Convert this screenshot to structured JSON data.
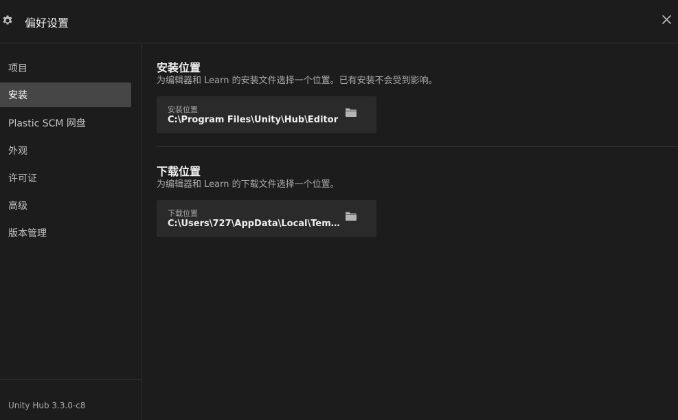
{
  "window": {
    "title": "偏好设置",
    "icons": {
      "settings": "gear-icon",
      "close": "close-icon"
    }
  },
  "sidebar": {
    "items": [
      {
        "label": "项目",
        "active": false
      },
      {
        "label": "安装",
        "active": true
      },
      {
        "label": "Plastic SCM 网盘",
        "active": false
      },
      {
        "label": "外观",
        "active": false
      },
      {
        "label": "许可证",
        "active": false
      },
      {
        "label": "高级",
        "active": false
      },
      {
        "label": "版本管理",
        "active": false
      }
    ],
    "version": "Unity Hub 3.3.0-c8"
  },
  "main": {
    "install": {
      "title": "安装位置",
      "description": "为编辑器和 Learn 的安装文件选择一个位置。已有安装不会受到影响。",
      "field_label": "安装位置",
      "field_value": "C:\\Program Files\\Unity\\Hub\\Editor",
      "icon": "folder-icon"
    },
    "download": {
      "title": "下载位置",
      "description": "为编辑器和 Learn 的下载文件选择一个位置。",
      "field_label": "下载位置",
      "field_value": "C:\\Users\\727\\AppData\\Local\\Temp\\...",
      "icon": "folder-icon"
    }
  },
  "colors": {
    "background": "#1c1c1c",
    "active_item": "#464646",
    "card": "#2a2a2a",
    "divider": "#303030"
  }
}
